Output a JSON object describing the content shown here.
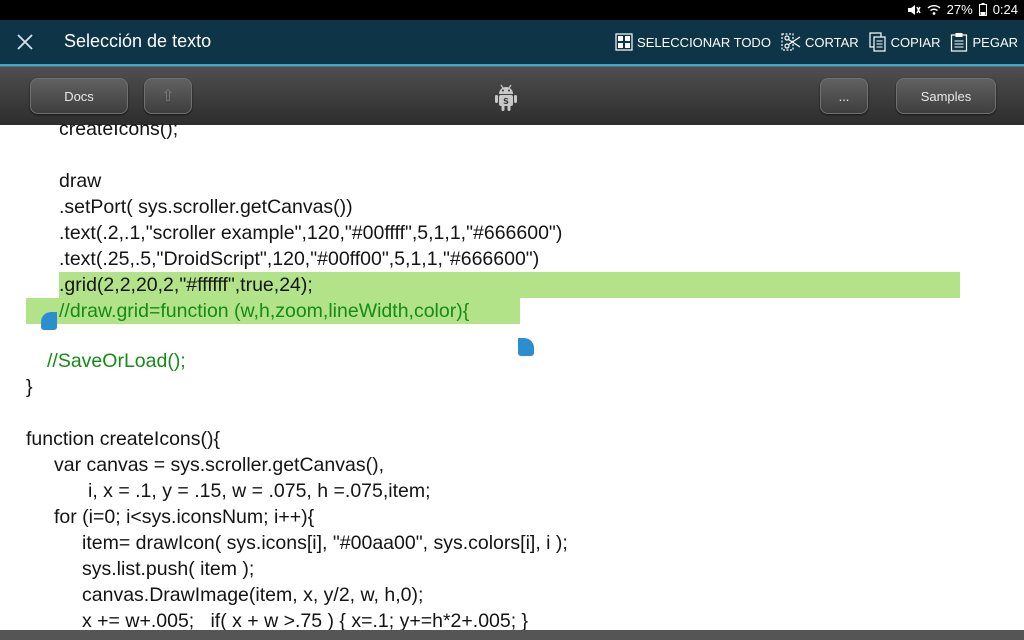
{
  "status": {
    "battery": "27%",
    "time": "0:24"
  },
  "action_bar": {
    "title": "Selección de texto",
    "actions": [
      {
        "label": "SELECCIONAR TODO",
        "icon": "select-all-icon"
      },
      {
        "label": "CORTAR",
        "icon": "scissors-icon"
      },
      {
        "label": "COPIAR",
        "icon": "copy-icon"
      },
      {
        "label": "PEGAR",
        "icon": "clipboard-icon"
      }
    ]
  },
  "toolbar": {
    "docs_label": "Docs",
    "up_label": "⇧",
    "more_label": "...",
    "samples_label": "Samples"
  },
  "code_lines": [
    "createIcons();",
    "",
    "draw",
    ".setPort( sys.scroller.getCanvas())",
    ".text(.2,.1,\"scroller example\",120,\"#00ffff\",5,1,1,\"#666600\")",
    ".text(.25,.5,\"DroidScript\",120,\"#00ff00\",5,1,1,\"#666600\")",
    ".grid(2,2,20,2,\"#ffffff\",true,24);",
    "//draw.grid=function (w,h,zoom,lineWidth,color){",
    "",
    "//SaveOrLoad();",
    "}",
    "",
    "function createIcons(){",
    "var canvas = sys.scroller.getCanvas(),",
    "i, x = .1, y = .15, w = .075, h =.075,item;",
    "for (i=0; i<sys.iconsNum; i++){",
    "item= drawIcon( sys.icons[i], \"#00aa00\", sys.colors[i], i );",
    "sys.list.push( item );",
    "canvas.DrawImage(item, x, y/2, w, h,0);",
    "x += w+.005;   if( x + w >.75 ) { x=.1; y+=h*2+.005; }"
  ]
}
